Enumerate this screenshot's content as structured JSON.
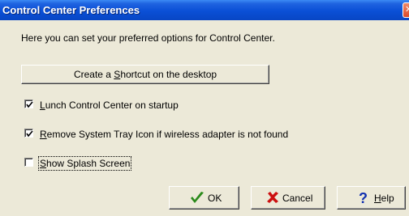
{
  "window": {
    "title": "Control Center Preferences",
    "close_icon": "close-icon"
  },
  "intro_text": "Here you can set your preferred options for Control Center.",
  "shortcut_button": {
    "pre": "Create a ",
    "mnemonic": "S",
    "post": "hortcut on the desktop"
  },
  "options": [
    {
      "pre": "",
      "mnemonic": "L",
      "post": "unch Control Center on startup",
      "checked": true
    },
    {
      "pre": "",
      "mnemonic": "R",
      "post": "emove System Tray Icon if wireless adapter is not found",
      "checked": true
    },
    {
      "pre": "",
      "mnemonic": "S",
      "post": "how Splash Screen",
      "checked": false
    }
  ],
  "buttons": {
    "ok": {
      "label": "OK",
      "icon": "checkmark-icon",
      "icon_color": "#2a8a1a"
    },
    "cancel": {
      "label": "Cancel",
      "icon": "x-icon",
      "icon_color": "#cc1010"
    },
    "help": {
      "pre": "",
      "mnemonic": "H",
      "post": "elp",
      "icon": "question-mark-icon",
      "icon_color": "#1030b0"
    }
  }
}
